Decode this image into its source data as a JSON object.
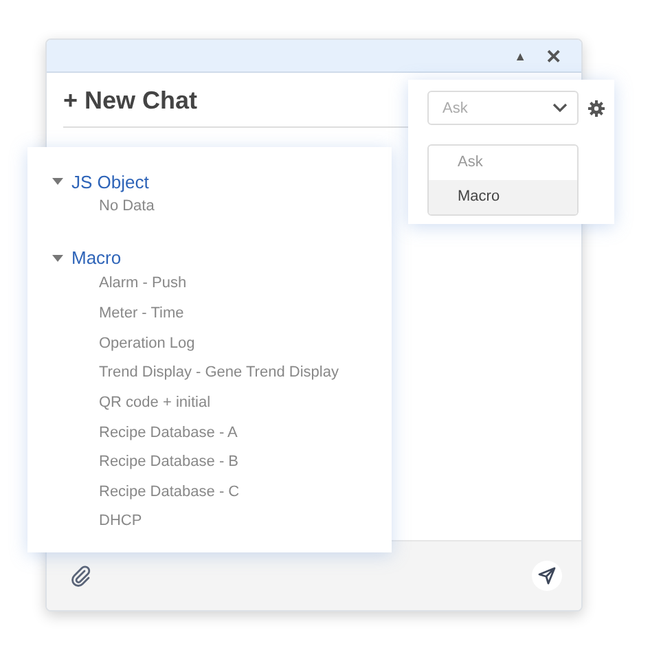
{
  "window": {
    "controls": [
      {
        "kind": "collapse",
        "glyph": "▲"
      },
      {
        "kind": "close",
        "glyph": "✕"
      }
    ]
  },
  "header": {
    "title": "+ New Chat"
  },
  "mode_select": {
    "value": "Ask",
    "options": [
      {
        "label": "Ask",
        "highlighted": false
      },
      {
        "label": "Macro",
        "highlighted": true
      }
    ]
  },
  "tree": [
    {
      "label": "JS Object",
      "expanded": true,
      "children": [
        {
          "label": "No Data"
        }
      ]
    },
    {
      "label": "Macro",
      "expanded": true,
      "children": [
        {
          "label": "Alarm - Push"
        },
        {
          "label": "Meter - Time"
        },
        {
          "label": "Operation Log"
        },
        {
          "label": "Trend Display - Gene Trend Display"
        },
        {
          "label": "QR code + initial"
        },
        {
          "label": "Recipe Database - A"
        },
        {
          "label": "Recipe Database - B"
        },
        {
          "label": "Recipe Database - C"
        },
        {
          "label": "DHCP"
        }
      ]
    }
  ]
}
